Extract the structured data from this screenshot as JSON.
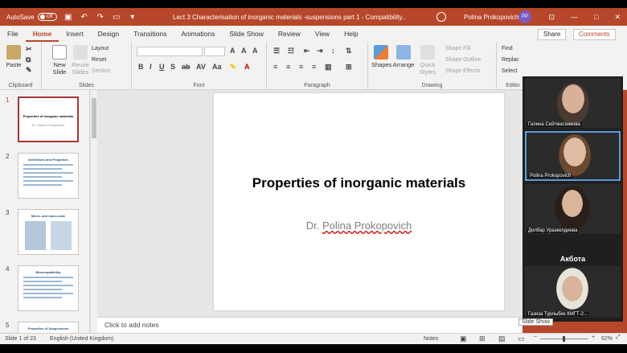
{
  "titlebar": {
    "autosave": "AutoSave",
    "autosave_state": "Off",
    "document_title": "Lect 3 Characterisation of inorganic materials -suspensions part 1  -  Compatibility...",
    "user_name": "Polina Prokopovich",
    "user_initials": "PP"
  },
  "tabs": [
    "File",
    "Home",
    "Insert",
    "Design",
    "Transitions",
    "Animations",
    "Slide Show",
    "Review",
    "View",
    "Help"
  ],
  "share_label": "Share",
  "comments_label": "Comments",
  "ribbon": {
    "clipboard": {
      "label": "Clipboard",
      "paste": "Paste"
    },
    "slides": {
      "label": "Slides",
      "new_slide": "New Slide",
      "reuse_slides": "Reuse Slides",
      "layout": "Layout",
      "reset": "Reset",
      "section": "Section"
    },
    "font": {
      "label": "Font"
    },
    "paragraph": {
      "label": "Paragraph"
    },
    "drawing": {
      "label": "Drawing",
      "shapes": "Shapes",
      "arrange": "Arrange",
      "quick_styles": "Quick Styles",
      "shape_fill": "Shape Fill",
      "shape_outline": "Shape Outline",
      "shape_effects": "Shape Effects"
    },
    "editing": {
      "label": "Editin",
      "find": "Find",
      "replace": "Replac",
      "select": "Select"
    }
  },
  "thumbnails": [
    {
      "num": "1",
      "title": "Properties of inorganic materials",
      "sub": "Dr. Polina Prokopovich"
    },
    {
      "num": "2",
      "title": "Definitions and Properties"
    },
    {
      "num": "3",
      "title": "Micro- and nano-scale"
    },
    {
      "num": "4",
      "title": "Biocompatibility"
    },
    {
      "num": "5",
      "title": "Properties of Suspensions"
    }
  ],
  "slide": {
    "title": "Properties of inorganic materials",
    "subtitle_prefix": "Dr. ",
    "subtitle_name": "Polina Prokopovich"
  },
  "notes_placeholder": "Click to add notes",
  "participants": [
    {
      "name": "Галина Сейтмагзимова"
    },
    {
      "name": "Polina Prokopovich"
    },
    {
      "name": "Дилбар Уразкелдиева"
    },
    {
      "name": "Акбота"
    },
    {
      "name": "Газиза Турлыбек КМГТ-2..."
    }
  ],
  "tooltip": "Slide Show",
  "status": {
    "slide_info": "Slide 1 of 23",
    "language": "English (United Kingdom)",
    "notes": "Notes",
    "zoom": "62%"
  },
  "colors": {
    "accent": "#b7472a",
    "slide_title": "#000000",
    "subtitle": "#7f7f7f"
  }
}
